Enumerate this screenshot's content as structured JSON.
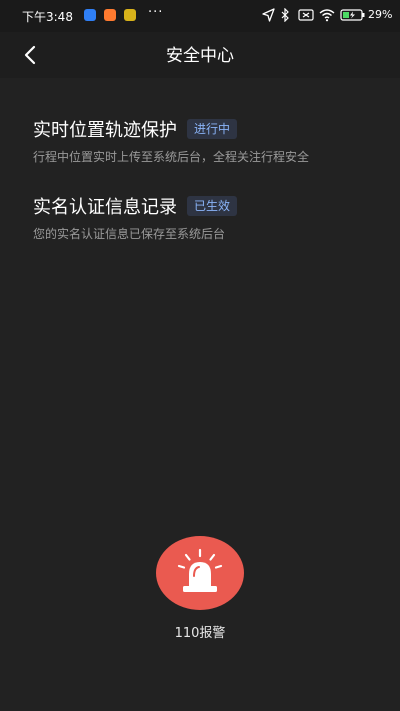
{
  "status_bar": {
    "time": "下午3:48",
    "more": "···",
    "battery_text": "29%"
  },
  "header": {
    "title": "安全中心"
  },
  "items": [
    {
      "title": "实时位置轨迹保护",
      "badge": "进行中",
      "description": "行程中位置实时上传至系统后台，全程关注行程安全"
    },
    {
      "title": "实名认证信息记录",
      "badge": "已生效",
      "description": "您的实名认证信息已保存至系统后台"
    }
  ],
  "alarm": {
    "label": "110报警",
    "color": "#ea5a50"
  },
  "colors": {
    "background": "#222222",
    "badge_text": "#8ab4f8",
    "badge_bg": "#2e3443"
  }
}
